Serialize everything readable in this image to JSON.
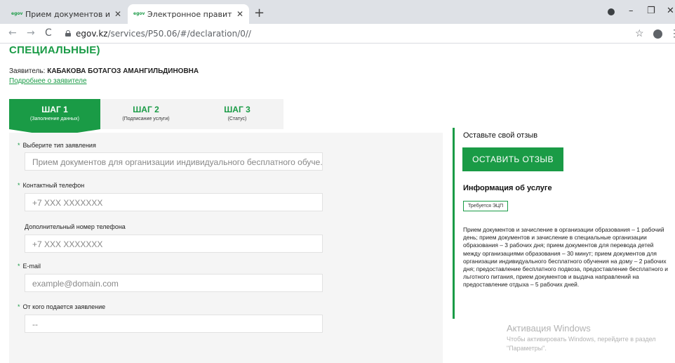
{
  "browser": {
    "tabs": [
      {
        "favicon": "egov",
        "title": "Прием документов и зачислен",
        "close": "✕"
      },
      {
        "favicon": "egov",
        "title": "Электронное правительство Ре",
        "close": "✕"
      }
    ],
    "new_tab": "+",
    "url_host": "egov.kz",
    "url_path": "/services/P50.06/#/declaration/0//",
    "window_controls": {
      "minimize": "–",
      "maximize": "❐",
      "close": "✕"
    },
    "nav": {
      "back": "←",
      "forward": "→",
      "reload": "C"
    },
    "star": "☆",
    "menu": "⋮"
  },
  "page": {
    "heading": "СПЕЦИАЛЬНЫЕ)",
    "applicant_label": "Заявитель:",
    "applicant_name": "КАБАКОВА БОТАГОЗ АМАНГИЛЬДИНОВНА",
    "applicant_link": "Подробнее о заявителе",
    "steps": [
      {
        "title": "ШАГ 1",
        "subtitle": "(Заполнение данных)",
        "active": true
      },
      {
        "title": "ШАГ 2",
        "subtitle": "(Подписание услуги)",
        "active": false
      },
      {
        "title": "ШАГ 3",
        "subtitle": "(Статус)",
        "active": false
      }
    ],
    "form": {
      "fields": [
        {
          "label": "Выберите тип заявления",
          "required": true,
          "value": "Прием документов для организации индивидуального бесплатного обуче..."
        },
        {
          "label": "Контактный телефон",
          "required": true,
          "value": "+7 XXX XXXXXXX"
        },
        {
          "label": "Дополнительный номер телефона",
          "required": false,
          "value": "+7 XXX XXXXXXX"
        },
        {
          "label": "E-mail",
          "required": true,
          "value": "example@domain.com"
        },
        {
          "label": "От кого подается заявление",
          "required": true,
          "value": "--"
        }
      ]
    },
    "sidebar": {
      "feedback_title": "Оставьте свой отзыв",
      "feedback_button": "ОСТАВИТЬ ОТЗЫВ",
      "info_title": "Информация об услуге",
      "badge": "Требуется ЭЦП",
      "description": "Прием документов и зачисление в организации образования – 1 рабочий день; прием документов и зачисление в специальные организации образования – 3 рабочих дня; прием документов для перевода детей между организациями образования – 30 минут; прием документов для организации индивидуального бесплатного обучения на дому – 2 рабочих дня; предоставление бесплатного подвоза, предоставление бесплатного и льготного питания, прием документов и выдача направлений на предоставление отдыха – 5 рабочих дней."
    },
    "watermark": {
      "title": "Активация Windows",
      "text": "Чтобы активировать Windows, перейдите в раздел \"Параметры\"."
    }
  },
  "colors": {
    "brand_green": "#1a9b46",
    "form_bg": "#f5f5f5",
    "tabbar_bg": "#dee1e6"
  }
}
